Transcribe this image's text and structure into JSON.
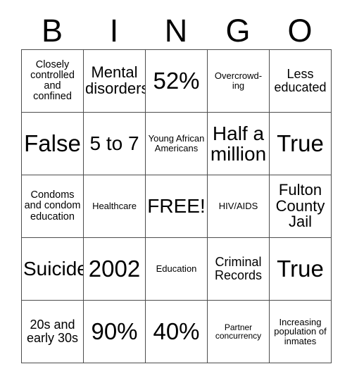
{
  "card": {
    "title": "BINGO",
    "header_letters": [
      "B",
      "I",
      "N",
      "G",
      "O"
    ],
    "free_space_label": "FREE!",
    "rows": [
      [
        {
          "text": "Closely controlled and confined",
          "size": "sm"
        },
        {
          "text": "Mental disorders",
          "size": "lg"
        },
        {
          "text": "52%",
          "size": "xxl"
        },
        {
          "text": "Overcrowd-ing",
          "size": "xs"
        },
        {
          "text": "Less educated",
          "size": "md"
        }
      ],
      [
        {
          "text": "False",
          "size": "xxl"
        },
        {
          "text": "5 to 7",
          "size": "xl"
        },
        {
          "text": "Young African Americans",
          "size": "xs"
        },
        {
          "text": "Half a million",
          "size": "xl"
        },
        {
          "text": "True",
          "size": "xxl"
        }
      ],
      [
        {
          "text": "Condoms and condom education",
          "size": "sm"
        },
        {
          "text": "Healthcare",
          "size": "xs"
        },
        {
          "text": "FREE!",
          "size": "xl"
        },
        {
          "text": "HIV/AIDS",
          "size": "xs"
        },
        {
          "text": "Fulton County Jail",
          "size": "lg"
        }
      ],
      [
        {
          "text": "Suicide",
          "size": "xl"
        },
        {
          "text": "2002",
          "size": "xxl"
        },
        {
          "text": "Education",
          "size": "xs"
        },
        {
          "text": "Criminal Records",
          "size": "md"
        },
        {
          "text": "True",
          "size": "xxl"
        }
      ],
      [
        {
          "text": "20s and early 30s",
          "size": "md"
        },
        {
          "text": "90%",
          "size": "xxl"
        },
        {
          "text": "40%",
          "size": "xxl"
        },
        {
          "text": "Partner concurrency",
          "size": "xxs"
        },
        {
          "text": "Increasing population of inmates",
          "size": "xs"
        }
      ]
    ]
  },
  "colors": {
    "background": "#ffffff",
    "text": "#000000",
    "grid_line": "#4d4d4d"
  }
}
